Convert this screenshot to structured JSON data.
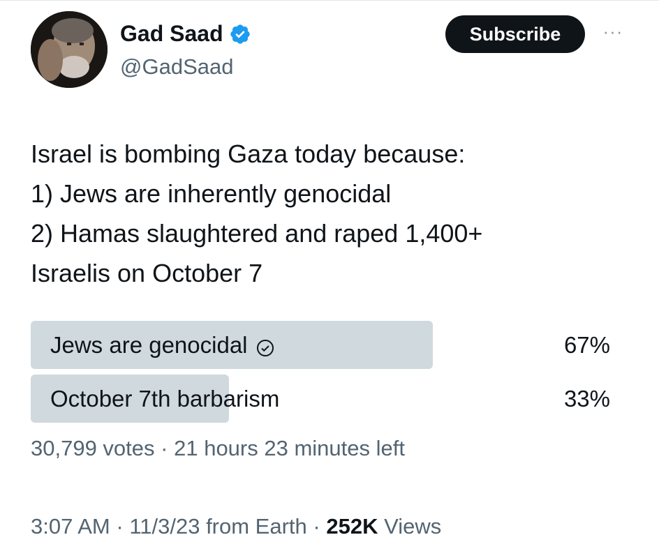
{
  "author": {
    "name": "Gad Saad",
    "handle": "@GadSaad",
    "verified_icon": "verified-badge-icon",
    "avatar_icon": "profile-photo"
  },
  "header": {
    "subscribe_label": "Subscribe",
    "more_icon": "more-options-icon",
    "more_glyph": "···"
  },
  "tweet": {
    "lines": [
      "Israel is bombing Gaza today because:",
      "1) Jews are inherently genocidal",
      "2) Hamas slaughtered and raped 1,400+",
      "Israelis on October 7"
    ]
  },
  "poll": {
    "options": [
      {
        "label": "Jews are genocidal",
        "percent_label": "67%",
        "percent": 67,
        "selected": true
      },
      {
        "label": "October 7th barbarism",
        "percent_label": "33%",
        "percent": 33,
        "selected": false
      }
    ],
    "votes": "30,799 votes",
    "separator": "·",
    "time_left": "21 hours 23 minutes left",
    "fill_color": "#cfd9de"
  },
  "meta": {
    "time": "3:07 AM",
    "separator": "·",
    "date_source": "11/3/23 from Earth",
    "views_count": "252K",
    "views_label": "Views"
  },
  "colors": {
    "text": "#0f1419",
    "secondary": "#536471",
    "verified_blue": "#1d9bf0",
    "button_bg": "#0f1419"
  }
}
